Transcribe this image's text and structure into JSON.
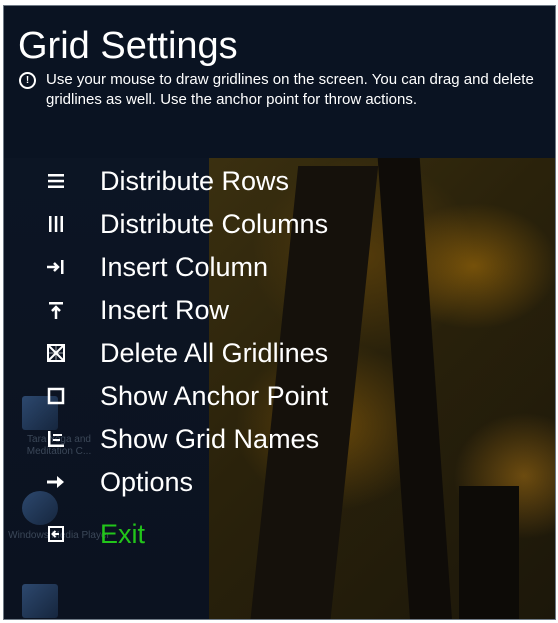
{
  "panel": {
    "title": "Grid Settings",
    "description": "Use your mouse to draw gridlines on the screen. You can drag and delete gridlines as well. Use the anchor point for throw actions."
  },
  "menu": {
    "items": [
      {
        "label": "Distribute Rows",
        "icon": "distribute-rows-icon"
      },
      {
        "label": "Distribute Columns",
        "icon": "distribute-columns-icon"
      },
      {
        "label": "Insert Column",
        "icon": "insert-column-icon"
      },
      {
        "label": "Insert Row",
        "icon": "insert-row-icon"
      },
      {
        "label": "Delete All Gridlines",
        "icon": "delete-gridlines-icon"
      },
      {
        "label": "Show Anchor Point",
        "icon": "anchor-point-icon"
      },
      {
        "label": "Show Grid Names",
        "icon": "grid-names-icon"
      },
      {
        "label": "Options",
        "icon": "arrow-right-icon"
      },
      {
        "label": "Exit",
        "icon": "exit-icon"
      }
    ]
  },
  "desktop": {
    "icons": [
      {
        "label": "Tara Yoga and Meditation C..."
      },
      {
        "label": "Windows Media Player"
      }
    ]
  },
  "colors": {
    "panel_bg": "#0a1322",
    "text": "#ffffff",
    "exit_green": "#22c51a"
  }
}
